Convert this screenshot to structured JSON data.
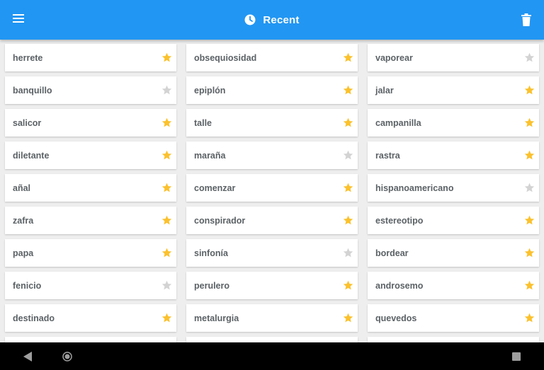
{
  "appbar": {
    "title": "Recent",
    "menu_icon": "hamburger-menu-icon",
    "title_icon": "clock-icon",
    "action_icon": "trash-icon",
    "background": "#2196f3"
  },
  "colors": {
    "star_active": "#fbc12d",
    "star_inactive": "#d3d3d3",
    "card_bg": "#ffffff",
    "page_bg": "#eeeeee"
  },
  "words": [
    {
      "text": "herrete",
      "favorite": true
    },
    {
      "text": "obsequiosidad",
      "favorite": true
    },
    {
      "text": "vaporear",
      "favorite": false
    },
    {
      "text": "banquillo",
      "favorite": false
    },
    {
      "text": "epiplón",
      "favorite": true
    },
    {
      "text": "jalar",
      "favorite": true
    },
    {
      "text": "salicor",
      "favorite": true
    },
    {
      "text": "talle",
      "favorite": true
    },
    {
      "text": "campanilla",
      "favorite": true
    },
    {
      "text": "diletante",
      "favorite": true
    },
    {
      "text": "maraña",
      "favorite": false
    },
    {
      "text": "rastra",
      "favorite": true
    },
    {
      "text": "añal",
      "favorite": true
    },
    {
      "text": "comenzar",
      "favorite": true
    },
    {
      "text": "hispanoamericano",
      "favorite": false
    },
    {
      "text": "zafra",
      "favorite": true
    },
    {
      "text": "conspirador",
      "favorite": true
    },
    {
      "text": "estereotipo",
      "favorite": true
    },
    {
      "text": "papa",
      "favorite": true
    },
    {
      "text": "sinfonía",
      "favorite": false
    },
    {
      "text": "bordear",
      "favorite": true
    },
    {
      "text": "fenicio",
      "favorite": false
    },
    {
      "text": "perulero",
      "favorite": true
    },
    {
      "text": "androsemo",
      "favorite": true
    },
    {
      "text": "destinado",
      "favorite": true
    },
    {
      "text": "metalurgia",
      "favorite": true
    },
    {
      "text": "quevedos",
      "favorite": true
    }
  ],
  "navbar": {
    "back_icon": "back-triangle-icon",
    "home_icon": "home-circle-icon",
    "recents_icon": "recents-square-icon"
  }
}
